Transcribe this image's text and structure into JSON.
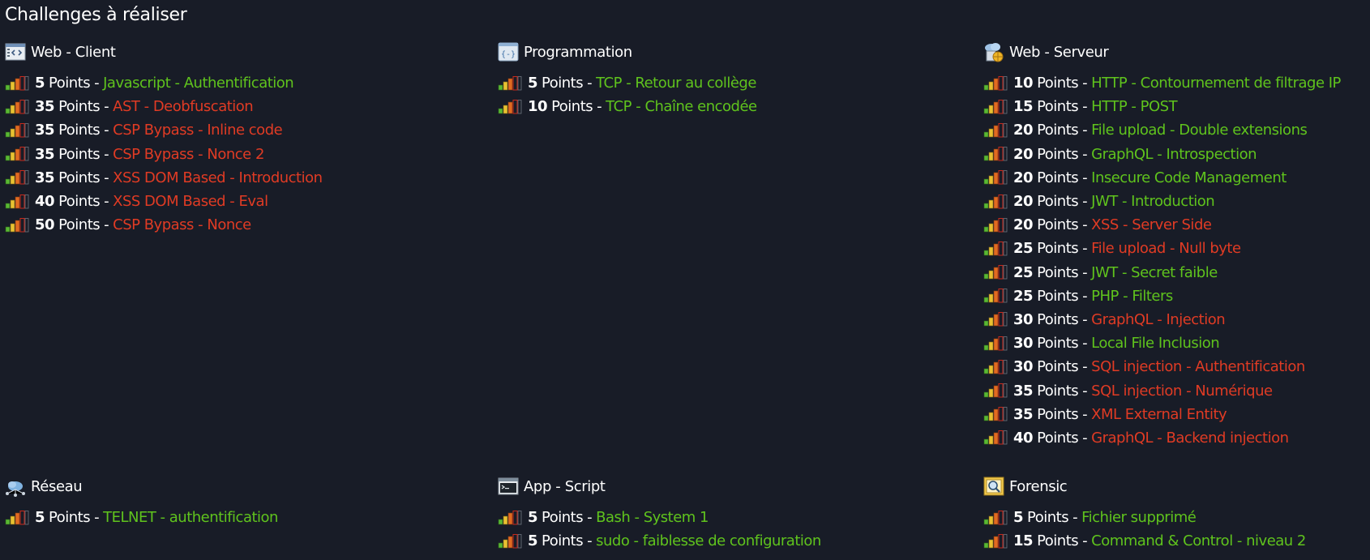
{
  "page_title": "Challenges à réaliser",
  "colors": {
    "background": "#181c27",
    "validated": "#5fc31d",
    "not_validated": "#e03b24",
    "text": "#ffffff"
  },
  "points_word": "Points",
  "separator": "-",
  "categories": [
    {
      "id": "web-client",
      "title": "Web - Client",
      "icon": "web-client-icon",
      "challenges": [
        {
          "points": "5",
          "name": "Javascript - Authentification",
          "status": "validated"
        },
        {
          "points": "35",
          "name": "AST - Deobfuscation",
          "status": "not_validated"
        },
        {
          "points": "35",
          "name": "CSP Bypass - Inline code",
          "status": "not_validated"
        },
        {
          "points": "35",
          "name": "CSP Bypass - Nonce 2",
          "status": "not_validated"
        },
        {
          "points": "35",
          "name": "XSS DOM Based - Introduction",
          "status": "not_validated"
        },
        {
          "points": "40",
          "name": "XSS DOM Based - Eval",
          "status": "not_validated"
        },
        {
          "points": "50",
          "name": "CSP Bypass - Nonce",
          "status": "not_validated"
        }
      ]
    },
    {
      "id": "programmation",
      "title": "Programmation",
      "icon": "programmation-icon",
      "challenges": [
        {
          "points": "5",
          "name": "TCP - Retour au collège",
          "status": "validated"
        },
        {
          "points": "10",
          "name": "TCP - Chaîne encodée",
          "status": "validated"
        }
      ]
    },
    {
      "id": "web-serveur",
      "title": "Web - Serveur",
      "icon": "web-serveur-icon",
      "challenges": [
        {
          "points": "10",
          "name": "HTTP - Contournement de filtrage IP",
          "status": "validated"
        },
        {
          "points": "15",
          "name": "HTTP - POST",
          "status": "validated"
        },
        {
          "points": "20",
          "name": "File upload - Double extensions",
          "status": "validated"
        },
        {
          "points": "20",
          "name": "GraphQL - Introspection",
          "status": "validated"
        },
        {
          "points": "20",
          "name": "Insecure Code Management",
          "status": "validated"
        },
        {
          "points": "20",
          "name": "JWT - Introduction",
          "status": "validated"
        },
        {
          "points": "20",
          "name": "XSS - Server Side",
          "status": "not_validated"
        },
        {
          "points": "25",
          "name": "File upload - Null byte",
          "status": "not_validated"
        },
        {
          "points": "25",
          "name": "JWT - Secret faible",
          "status": "validated"
        },
        {
          "points": "25",
          "name": "PHP - Filters",
          "status": "validated"
        },
        {
          "points": "30",
          "name": "GraphQL - Injection",
          "status": "not_validated"
        },
        {
          "points": "30",
          "name": "Local File Inclusion",
          "status": "validated"
        },
        {
          "points": "30",
          "name": "SQL injection - Authentification",
          "status": "not_validated"
        },
        {
          "points": "35",
          "name": "SQL injection - Numérique",
          "status": "not_validated"
        },
        {
          "points": "35",
          "name": "XML External Entity",
          "status": "not_validated"
        },
        {
          "points": "40",
          "name": "GraphQL - Backend injection",
          "status": "not_validated"
        }
      ]
    },
    {
      "id": "reseau",
      "title": "Réseau",
      "icon": "reseau-icon",
      "challenges": [
        {
          "points": "5",
          "name": "TELNET - authentification",
          "status": "validated"
        }
      ]
    },
    {
      "id": "app-script",
      "title": "App - Script",
      "icon": "app-script-icon",
      "challenges": [
        {
          "points": "5",
          "name": "Bash - System 1",
          "status": "validated"
        },
        {
          "points": "5",
          "name": "sudo - faiblesse de configuration",
          "status": "validated"
        }
      ]
    },
    {
      "id": "forensic",
      "title": "Forensic",
      "icon": "forensic-icon",
      "challenges": [
        {
          "points": "5",
          "name": "Fichier supprimé",
          "status": "validated"
        },
        {
          "points": "15",
          "name": "Command & Control - niveau 2",
          "status": "validated"
        }
      ]
    }
  ]
}
